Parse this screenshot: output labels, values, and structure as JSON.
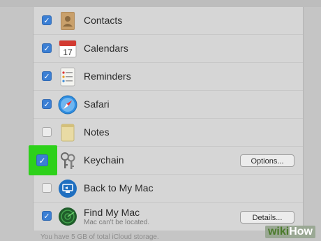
{
  "rows": [
    {
      "id": "contacts",
      "label": "Contacts",
      "checked": true,
      "icon": "contacts-icon"
    },
    {
      "id": "calendars",
      "label": "Calendars",
      "checked": true,
      "icon": "calendar-icon",
      "calendar_day": "17"
    },
    {
      "id": "reminders",
      "label": "Reminders",
      "checked": true,
      "icon": "reminders-icon"
    },
    {
      "id": "safari",
      "label": "Safari",
      "checked": true,
      "icon": "safari-icon"
    },
    {
      "id": "notes",
      "label": "Notes",
      "checked": false,
      "icon": "notes-icon"
    },
    {
      "id": "keychain",
      "label": "Keychain",
      "checked": true,
      "icon": "keychain-icon",
      "button": "Options..."
    },
    {
      "id": "back-to-my-mac",
      "label": "Back to My Mac",
      "checked": false,
      "icon": "back-to-my-mac-icon"
    },
    {
      "id": "find-my-mac",
      "label": "Find My Mac",
      "checked": true,
      "icon": "find-my-mac-icon",
      "sublabel": "Mac can't be located.",
      "button": "Details..."
    }
  ],
  "check_glyph": "✓",
  "footer": "You have 5 GB of total iCloud storage.",
  "watermark": {
    "prefix": "wiki",
    "suffix": "How"
  },
  "colors": {
    "highlight": "#2dd11a",
    "checkbox_on": "#3b7fd4"
  }
}
